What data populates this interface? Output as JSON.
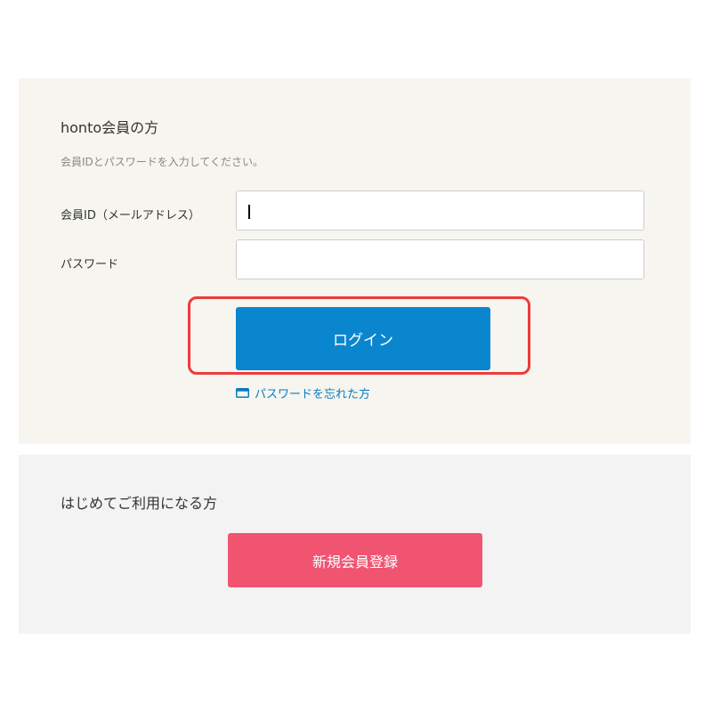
{
  "member_section": {
    "heading": "honto会員の方",
    "instruction": "会員IDとパスワードを入力してください。",
    "id_label": "会員ID（メールアドレス）",
    "id_value": "",
    "password_label": "パスワード",
    "password_value": "",
    "login_label": "ログイン",
    "forgot_label": "パスワードを忘れた方",
    "forgot_icon": "window-icon",
    "accent_color": "#0a86cf",
    "highlight_color": "#ee3b3b"
  },
  "new_section": {
    "heading": "はじめてご利用になる方",
    "register_label": "新規会員登録",
    "accent_color": "#f15470"
  }
}
